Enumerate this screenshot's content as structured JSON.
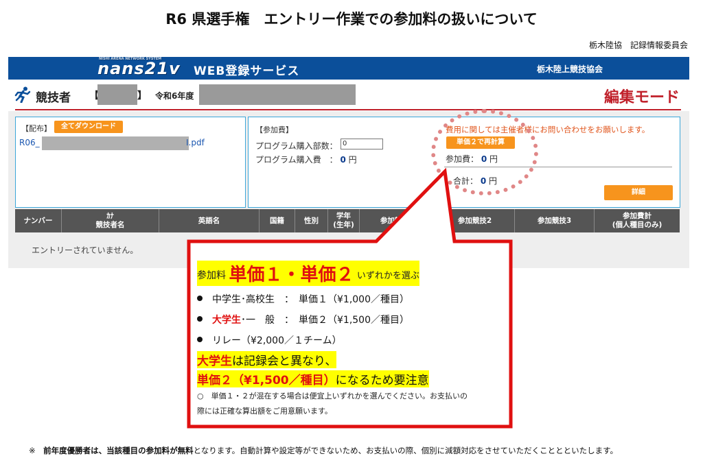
{
  "doc": {
    "title": "R6 県選手権　エントリー作業での参加料の扱いについて",
    "org": "栃木陸協　記録情報委員会"
  },
  "header": {
    "logo": "nans21v",
    "logo_sub": "NISHI ARENA NETWORK SYSTEM",
    "service": "WEB登録サービス",
    "association": "栃木陸上競技協会"
  },
  "athlete": {
    "label": "競技者",
    "bracket_open": "【",
    "bracket_close": "】",
    "year": "令和6年度",
    "mode": "編集モード"
  },
  "distribution": {
    "label": "【配布】",
    "download_all": "全てダウンロード",
    "pdf_prefix": "R06_",
    "pdf_suffix": "I.pdf"
  },
  "fee": {
    "label": "【参加費】",
    "program_qty_label": "プログラム購入部数：",
    "program_qty_value": "0",
    "program_cost_label": "プログラム購入費　：",
    "program_cost_value": "0",
    "yen": "円",
    "notice": "費用に関しては主催者様にお問い合わせをお願いします。",
    "recalc_button": "単価２で再計算",
    "entry_fee_label": "参加費：",
    "entry_fee_value": "0",
    "total_label": "合計：",
    "total_value": "0",
    "detail_button": "詳細"
  },
  "table": {
    "headers": [
      "ナンバー",
      "ｶﾅ\n競技者名",
      "英語名",
      "国籍",
      "性別",
      "学年\n(生年)",
      "参加競技1",
      "参加競技2",
      "参加競技3",
      "参加費計\n(個人種目のみ)"
    ],
    "empty_message": "エントリーされていません。"
  },
  "callout": {
    "line1_prefix": "参加料",
    "line1_big": "単価１・単価２",
    "line1_suffix": "いずれかを選ぶ",
    "bullet1": "中学生･高校生　：　単価１（¥1,000／種目）",
    "bullet2_red": "大学生",
    "bullet2_rest": "･一　般　：　単価２（¥1,500／種目）",
    "bullet3": "リレー（¥2,000／１チーム）",
    "emph1_red": "大学生",
    "emph1_rest": "は記録会と異なり、",
    "emph2_red": "単価２（¥1,500／種目）",
    "emph2_rest": "になるため要注意",
    "note_line1": "○　単価１・２が混在する場合は便宜上いずれかを選んでください。お支払いの",
    "note_line2": "際には正確な算出額をご用意願います。"
  },
  "footer": {
    "mark": "※",
    "bold": "前年度優勝者は、当該種目の参加料が無料",
    "rest": "となります。自動計算や設定等ができないため、お支払いの際、個別に減額対応をさせていただくこととといたします。"
  },
  "colors": {
    "header_blue": "#0b4f9a",
    "accent_orange": "#f7941d",
    "edit_red": "#c0202a",
    "callout_red": "#e01010",
    "highlight_yellow": "#ffff00",
    "box_border": "#3aa6d9"
  }
}
